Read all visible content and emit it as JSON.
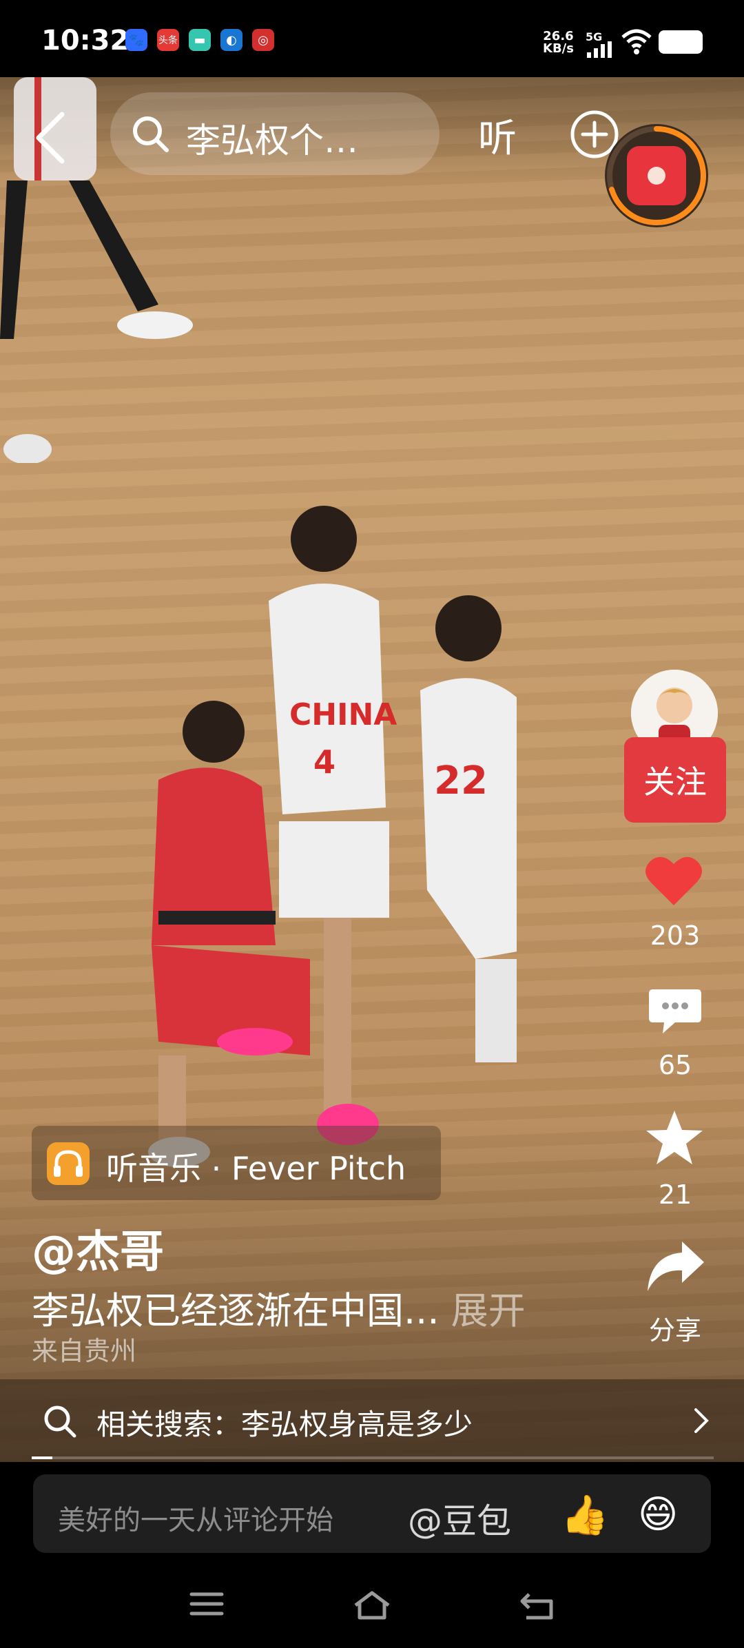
{
  "status_bar": {
    "time": "10:32",
    "notifications": [
      {
        "icon": "baidu-paw-icon",
        "color": "#2f6bff"
      },
      {
        "icon": "toutiao-icon",
        "text": "头条",
        "color": "#e53935"
      },
      {
        "icon": "message-app-icon",
        "color": "#35c6b0"
      },
      {
        "icon": "browser-icon",
        "color": "#1976d2"
      },
      {
        "icon": "app-red-icon",
        "color": "#d32f2f"
      }
    ],
    "net_speed": "26.6",
    "net_speed_unit": "KB/s",
    "network": "5G"
  },
  "top_bar": {
    "search_text": "李弘权个…",
    "listen_label": "听"
  },
  "right_column": {
    "follow_label": "关注",
    "likes": "203",
    "comments": "65",
    "favorites": "21",
    "share_label": "分享"
  },
  "video_info": {
    "music_label": "听音乐 · Fever Pitch",
    "author": "@杰哥",
    "description": "李弘权已经逐渐在中国...",
    "expand_label": "展开",
    "location": "来自贵州",
    "related_search": "相关搜索：李弘权身高是多少",
    "progress": 0.03
  },
  "comment_bar": {
    "placeholder": "美好的一天从评论开始",
    "mention": "@豆包",
    "emoji_1": "👍",
    "emoji_2": "😄"
  },
  "colors": {
    "accent_red": "#e23a3e",
    "like_red": "#f03c3c",
    "music_icon": "#f4a02c"
  }
}
